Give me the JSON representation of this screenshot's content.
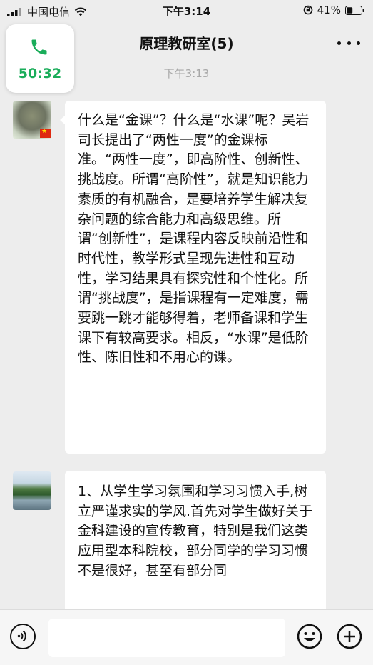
{
  "status_bar": {
    "carrier": "中国电信",
    "time": "下午3:14",
    "battery_percent": "41%",
    "battery_level": 0.41
  },
  "header": {
    "title": "原理教研室(5)",
    "more_icon": "more-dots-icon"
  },
  "call_floating": {
    "icon": "phone-icon",
    "duration": "50:32",
    "accent_color": "#1aad5a"
  },
  "chat": {
    "timestamp": "下午3:13",
    "messages": [
      {
        "avatar": "avatar-photo",
        "text": "什么是“金课”？什么是“水课”呢？吴岩司长提出了“两性一度”的金课标准。“两性一度”，即高阶性、创新性、挑战度。所谓“高阶性”，就是知识能力素质的有机融合，是要培养学生解决复杂问题的综合能力和高级思维。所谓“创新性”，是课程内容反映前沿性和时代性，教学形式呈现先进性和互动性，学习结果具有探究性和个性化。所谓“挑战度”，是指课程有一定难度，需要跳一跳才能够得着，老师备课和学生课下有较高要求。相反，“水课”是低阶性、陈旧性和不用心的课。"
      },
      {
        "avatar": "avatar-landscape",
        "text": "1、从学生学习氛围和学习习惯入手,树立严谨求实的学风.首先对学生做好关于金科建设的宣传教育，特别是我们这类应用型本科院校，部分同学的学习习惯不是很好，甚至有部分同"
      }
    ]
  },
  "input_bar": {
    "voice_icon": "voice-icon",
    "emoji_icon": "emoji-icon",
    "plus_icon": "plus-icon",
    "input_value": ""
  }
}
